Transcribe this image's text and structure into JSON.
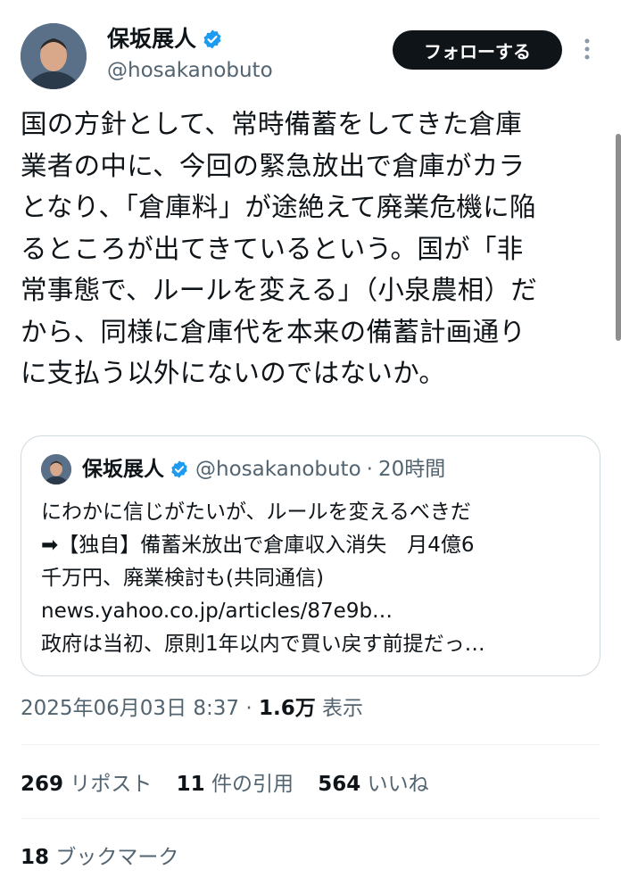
{
  "author": {
    "name": "保坂展人",
    "handle": "@hosakanobuto",
    "follow_label": "フォローする"
  },
  "tweet": {
    "text": "国の方針として、常時備蓄をしてきた倉庫\n業者の中に、今回の緊急放出で倉庫がカラ\nとなり、「倉庫料」が途絶えて廃業危機に陥\nるところが出てきているという。国が「非\n常事態で、ルールを変える」（小泉農相）だ\nから、同様に倉庫代を本来の備蓄計画通り\nに支払う以外にないのではないか。"
  },
  "quote": {
    "name": "保坂展人",
    "handle": "@hosakanobuto",
    "dot": "·",
    "time": "20時間",
    "lines": [
      "にわかに信じがたいが、ルールを変えるべきだ",
      "➡【独自】備蓄米放出で倉庫収入消失　月4億6",
      "千万円、廃業検討も(共同通信)",
      "news.yahoo.co.jp/articles/87e9b…",
      "政府は当初、原則1年以内で買い戻す前提だっ…"
    ]
  },
  "meta": {
    "timestamp": "2025年06月03日 8:37",
    "dot": " · ",
    "views": "1.6万",
    "views_label": " 表示"
  },
  "stats": {
    "reposts_count": "269",
    "reposts_label": " リポスト",
    "quotes_count": "11",
    "quotes_label": " 件の引用",
    "likes_count": "564",
    "likes_label": " いいね"
  },
  "bookmarks": {
    "count": "18",
    "label": " ブックマーク"
  },
  "colors": {
    "verified": "#1d9bf0",
    "text": "#0f1419",
    "secondary": "#536471",
    "border": "#cfd9de"
  }
}
